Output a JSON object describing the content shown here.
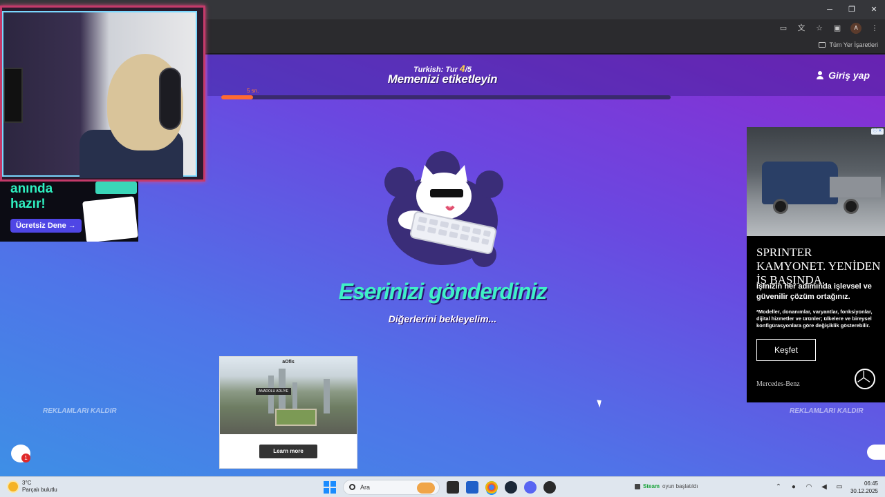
{
  "browser": {
    "window_controls": [
      "─",
      "❐",
      "✕"
    ],
    "bookmarks_bar": {
      "all_bookmarks": "Tüm Yer İşaretleri"
    },
    "profile_initial": "A"
  },
  "game": {
    "round_prefix": "Turkish: Tur",
    "round_current": "4",
    "round_total": "/5",
    "prompt_title": "Memenizi etiketleyin",
    "login_label": "Giriş yap",
    "timer_label": "5 sn.",
    "timer_fraction": 0.07,
    "submitted_title": "Eserinizi gönderdiniz",
    "waiting_text": "Diğerlerini bekleyelim...",
    "remove_ads_left": "REKLAMLARI KALDIR",
    "remove_ads_right": "REKLAMLARI KALDIR",
    "chat_badge_count": "1"
  },
  "ad_bottom": {
    "logo": "aOfis",
    "tag": "ANADOLU ADLİYE",
    "button_label": "Learn more"
  },
  "ad_right": {
    "adchoices": "ⓘ ✕",
    "title": "SPRINTER KAMYONET. YENİDEN İŞ BAŞINDA.",
    "description": "İşinizin her adımında işlevsel ve güvenilir çözüm ortağınız.",
    "fine_print": "*Modeller, donanımlar, varyantlar, fonksiyonlar, dijital hizmetler ve ürünler; ülkelere ve bireysel konfigürasyonlara göre değişiklik gösterebilir.",
    "button_label": "Keşfet",
    "brand": "Mercedes-Benz"
  },
  "promo_ad": {
    "line1": "anında",
    "line2": "hazır!",
    "button_label": "Ücretsiz Dene →"
  },
  "taskbar": {
    "weather_temp": "3°C",
    "weather_desc": "Parçalı bulutlu",
    "search_placeholder": "Ara",
    "notification_app": "Steam",
    "notification_text": "oyun başlatıldı",
    "time": "06:45",
    "date": "30.12.2025"
  },
  "colors": {
    "accent_teal": "#3ff0c6",
    "timer_orange": "#ff6a32",
    "round_yellow": "#ffd64a"
  }
}
